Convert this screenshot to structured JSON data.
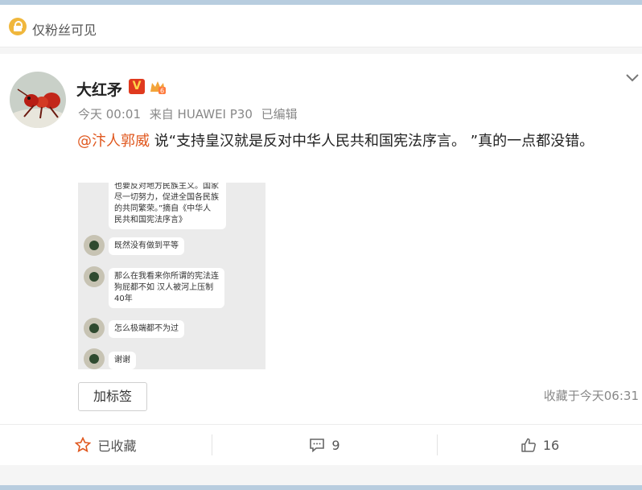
{
  "visibility": {
    "label": "仅粉丝可见",
    "icon": "lock-icon"
  },
  "post": {
    "author": "大红矛",
    "verified_badge": "V",
    "time": "今天 00:01",
    "source": "来自 HUAWEI P30",
    "edited": "已编辑",
    "mention": "@汴人郭威",
    "text": " 说“支持皇汉就是反对中华人民共和国宪法序言。 ”真的一点都没错。",
    "screenshot_chat": {
      "quote": "也要反对地方民族主义。国家\n尽一切努力，促进全国各民族\n的共同繁荣。”摘自《中华人\n民共和国宪法序言》",
      "messages": [
        "既然没有做到平等",
        "那么在我看来你所谓的宪法连\n狗屁都不如 汉人被河上压制\n40年",
        "怎么极端都不为过",
        "谢谢"
      ]
    },
    "tag_button": "加标签",
    "favorited_time": "收藏于今天06:31"
  },
  "actions": {
    "favorite": {
      "label": "已收藏",
      "icon": "star-outline-icon"
    },
    "comment": {
      "count": "9",
      "icon": "comment-icon"
    },
    "like": {
      "count": "16",
      "icon": "thumbs-up-icon"
    }
  },
  "colors": {
    "accent": "#e0581f",
    "vip_badge": "#e03a1e",
    "lock": "#f0b73c"
  }
}
